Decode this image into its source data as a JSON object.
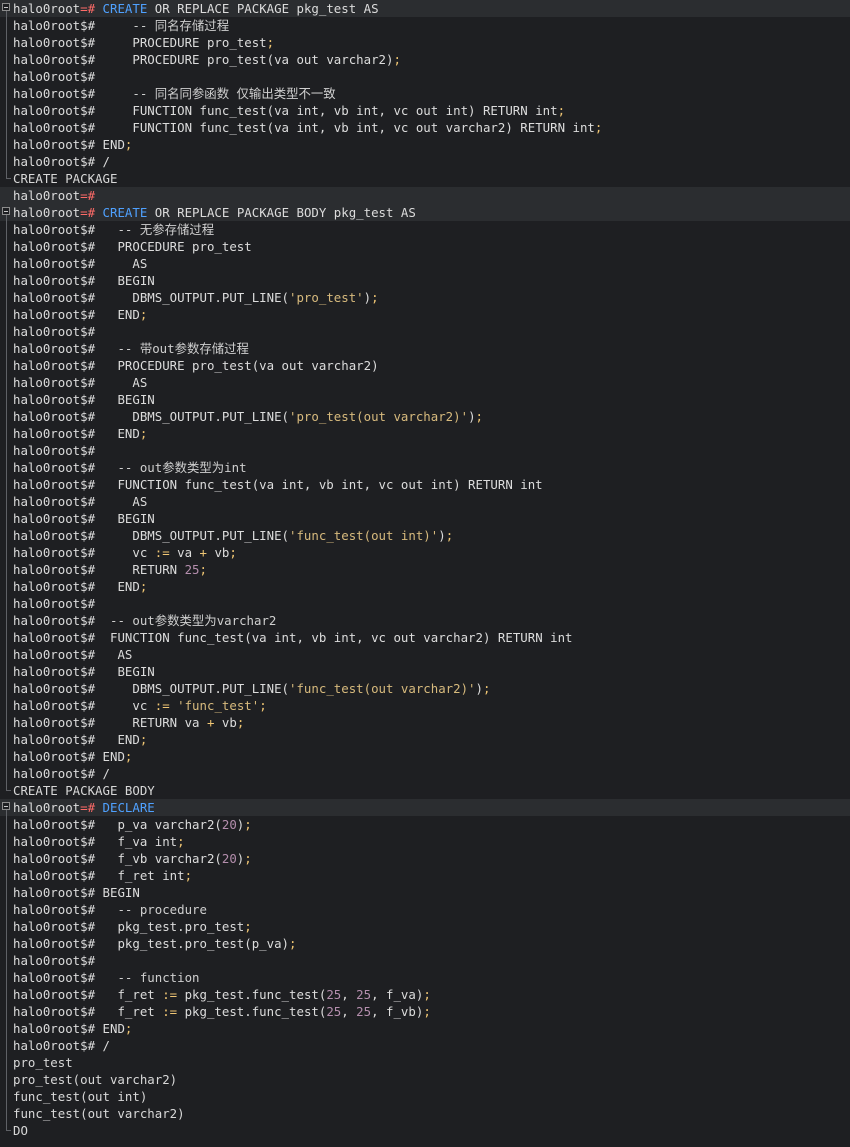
{
  "terminal": {
    "lines": [
      {
        "gutter": "start",
        "hl": true,
        "segs": [
          [
            "t-prompt",
            "halo0root"
          ],
          [
            "t-prompt-accent",
            "=# "
          ],
          [
            "t-kw",
            "CREATE"
          ],
          [
            "t-text",
            " OR REPLACE PACKAGE pkg_test AS"
          ]
        ]
      },
      {
        "gutter": "mid",
        "segs": [
          [
            "t-prompt",
            "halo0root$#     "
          ],
          [
            "t-comment",
            "-- 同名存储过程"
          ]
        ]
      },
      {
        "gutter": "mid",
        "segs": [
          [
            "t-prompt",
            "halo0root$#     "
          ],
          [
            "t-text",
            "PROCEDURE pro_test"
          ],
          [
            "t-op",
            ";"
          ]
        ]
      },
      {
        "gutter": "mid",
        "segs": [
          [
            "t-prompt",
            "halo0root$#     "
          ],
          [
            "t-text",
            "PROCEDURE pro_test(va out varchar2)"
          ],
          [
            "t-op",
            ";"
          ]
        ]
      },
      {
        "gutter": "mid",
        "segs": [
          [
            "t-prompt",
            "halo0root$#"
          ]
        ]
      },
      {
        "gutter": "mid",
        "segs": [
          [
            "t-prompt",
            "halo0root$#     "
          ],
          [
            "t-comment",
            "-- 同名同参函数 仅输出类型不一致"
          ]
        ]
      },
      {
        "gutter": "mid",
        "segs": [
          [
            "t-prompt",
            "halo0root$#     "
          ],
          [
            "t-text",
            "FUNCTION func_test(va int, vb int, vc out int) RETURN int"
          ],
          [
            "t-op",
            ";"
          ]
        ]
      },
      {
        "gutter": "mid",
        "segs": [
          [
            "t-prompt",
            "halo0root$#     "
          ],
          [
            "t-text",
            "FUNCTION func_test(va int, vb int, vc out varchar2) RETURN int"
          ],
          [
            "t-op",
            ";"
          ]
        ]
      },
      {
        "gutter": "mid",
        "segs": [
          [
            "t-prompt",
            "halo0root$# "
          ],
          [
            "t-text",
            "END"
          ],
          [
            "t-op",
            ";"
          ]
        ]
      },
      {
        "gutter": "mid",
        "segs": [
          [
            "t-prompt",
            "halo0root$# "
          ],
          [
            "t-text",
            "/"
          ]
        ]
      },
      {
        "gutter": "end",
        "segs": [
          [
            "t-out",
            "CREATE PACKAGE"
          ]
        ]
      },
      {
        "gutter": "none",
        "hl": true,
        "segs": [
          [
            "t-prompt",
            "halo0root"
          ],
          [
            "t-prompt-accent",
            "=#"
          ]
        ]
      },
      {
        "gutter": "start",
        "hl": true,
        "segs": [
          [
            "t-prompt",
            "halo0root"
          ],
          [
            "t-prompt-accent",
            "=# "
          ],
          [
            "t-kw",
            "CREATE"
          ],
          [
            "t-text",
            " OR REPLACE PACKAGE BODY pkg_test AS"
          ]
        ]
      },
      {
        "gutter": "mid",
        "segs": [
          [
            "t-prompt",
            "halo0root$#   "
          ],
          [
            "t-comment",
            "-- 无参存储过程"
          ]
        ]
      },
      {
        "gutter": "mid",
        "segs": [
          [
            "t-prompt",
            "halo0root$#   "
          ],
          [
            "t-text",
            "PROCEDURE pro_test"
          ]
        ]
      },
      {
        "gutter": "mid",
        "segs": [
          [
            "t-prompt",
            "halo0root$#     "
          ],
          [
            "t-text",
            "AS"
          ]
        ]
      },
      {
        "gutter": "mid",
        "segs": [
          [
            "t-prompt",
            "halo0root$#   "
          ],
          [
            "t-text",
            "BEGIN"
          ]
        ]
      },
      {
        "gutter": "mid",
        "segs": [
          [
            "t-prompt",
            "halo0root$#     "
          ],
          [
            "t-text",
            "DBMS_OUTPUT.PUT_LINE("
          ],
          [
            "t-str",
            "'pro_test'"
          ],
          [
            "t-text",
            ")"
          ],
          [
            "t-op",
            ";"
          ]
        ]
      },
      {
        "gutter": "mid",
        "segs": [
          [
            "t-prompt",
            "halo0root$#   "
          ],
          [
            "t-text",
            "END"
          ],
          [
            "t-op",
            ";"
          ]
        ]
      },
      {
        "gutter": "mid",
        "segs": [
          [
            "t-prompt",
            "halo0root$#"
          ]
        ]
      },
      {
        "gutter": "mid",
        "segs": [
          [
            "t-prompt",
            "halo0root$#   "
          ],
          [
            "t-comment",
            "-- 带out参数存储过程"
          ]
        ]
      },
      {
        "gutter": "mid",
        "segs": [
          [
            "t-prompt",
            "halo0root$#   "
          ],
          [
            "t-text",
            "PROCEDURE pro_test(va out varchar2)"
          ]
        ]
      },
      {
        "gutter": "mid",
        "segs": [
          [
            "t-prompt",
            "halo0root$#     "
          ],
          [
            "t-text",
            "AS"
          ]
        ]
      },
      {
        "gutter": "mid",
        "segs": [
          [
            "t-prompt",
            "halo0root$#   "
          ],
          [
            "t-text",
            "BEGIN"
          ]
        ]
      },
      {
        "gutter": "mid",
        "segs": [
          [
            "t-prompt",
            "halo0root$#     "
          ],
          [
            "t-text",
            "DBMS_OUTPUT.PUT_LINE("
          ],
          [
            "t-str",
            "'pro_test(out varchar2)'"
          ],
          [
            "t-text",
            ")"
          ],
          [
            "t-op",
            ";"
          ]
        ]
      },
      {
        "gutter": "mid",
        "segs": [
          [
            "t-prompt",
            "halo0root$#   "
          ],
          [
            "t-text",
            "END"
          ],
          [
            "t-op",
            ";"
          ]
        ]
      },
      {
        "gutter": "mid",
        "segs": [
          [
            "t-prompt",
            "halo0root$#"
          ]
        ]
      },
      {
        "gutter": "mid",
        "segs": [
          [
            "t-prompt",
            "halo0root$#   "
          ],
          [
            "t-comment",
            "-- out参数类型为int"
          ]
        ]
      },
      {
        "gutter": "mid",
        "segs": [
          [
            "t-prompt",
            "halo0root$#   "
          ],
          [
            "t-text",
            "FUNCTION func_test(va int, vb int, vc out int) RETURN int"
          ]
        ]
      },
      {
        "gutter": "mid",
        "segs": [
          [
            "t-prompt",
            "halo0root$#     "
          ],
          [
            "t-text",
            "AS"
          ]
        ]
      },
      {
        "gutter": "mid",
        "segs": [
          [
            "t-prompt",
            "halo0root$#   "
          ],
          [
            "t-text",
            "BEGIN"
          ]
        ]
      },
      {
        "gutter": "mid",
        "segs": [
          [
            "t-prompt",
            "halo0root$#     "
          ],
          [
            "t-text",
            "DBMS_OUTPUT.PUT_LINE("
          ],
          [
            "t-str",
            "'func_test(out int)'"
          ],
          [
            "t-text",
            ")"
          ],
          [
            "t-op",
            ";"
          ]
        ]
      },
      {
        "gutter": "mid",
        "segs": [
          [
            "t-prompt",
            "halo0root$#     "
          ],
          [
            "t-text",
            "vc "
          ],
          [
            "t-op",
            ":="
          ],
          [
            "t-text",
            " va "
          ],
          [
            "t-op",
            "+"
          ],
          [
            "t-text",
            " vb"
          ],
          [
            "t-op",
            ";"
          ]
        ]
      },
      {
        "gutter": "mid",
        "segs": [
          [
            "t-prompt",
            "halo0root$#     "
          ],
          [
            "t-text",
            "RETURN "
          ],
          [
            "t-num",
            "25"
          ],
          [
            "t-op",
            ";"
          ]
        ]
      },
      {
        "gutter": "mid",
        "segs": [
          [
            "t-prompt",
            "halo0root$#   "
          ],
          [
            "t-text",
            "END"
          ],
          [
            "t-op",
            ";"
          ]
        ]
      },
      {
        "gutter": "mid",
        "segs": [
          [
            "t-prompt",
            "halo0root$#"
          ]
        ]
      },
      {
        "gutter": "mid",
        "segs": [
          [
            "t-prompt",
            "halo0root$#  "
          ],
          [
            "t-comment",
            "-- out参数类型为varchar2"
          ]
        ]
      },
      {
        "gutter": "mid",
        "segs": [
          [
            "t-prompt",
            "halo0root$#  "
          ],
          [
            "t-text",
            "FUNCTION func_test(va int, vb int, vc out varchar2) RETURN int"
          ]
        ]
      },
      {
        "gutter": "mid",
        "segs": [
          [
            "t-prompt",
            "halo0root$#   "
          ],
          [
            "t-text",
            "AS"
          ]
        ]
      },
      {
        "gutter": "mid",
        "segs": [
          [
            "t-prompt",
            "halo0root$#   "
          ],
          [
            "t-text",
            "BEGIN"
          ]
        ]
      },
      {
        "gutter": "mid",
        "segs": [
          [
            "t-prompt",
            "halo0root$#     "
          ],
          [
            "t-text",
            "DBMS_OUTPUT.PUT_LINE("
          ],
          [
            "t-str",
            "'func_test(out varchar2)'"
          ],
          [
            "t-text",
            ")"
          ],
          [
            "t-op",
            ";"
          ]
        ]
      },
      {
        "gutter": "mid",
        "segs": [
          [
            "t-prompt",
            "halo0root$#     "
          ],
          [
            "t-text",
            "vc "
          ],
          [
            "t-op",
            ":="
          ],
          [
            "t-text",
            " "
          ],
          [
            "t-str",
            "'func_test'"
          ],
          [
            "t-op",
            ";"
          ]
        ]
      },
      {
        "gutter": "mid",
        "segs": [
          [
            "t-prompt",
            "halo0root$#     "
          ],
          [
            "t-text",
            "RETURN va "
          ],
          [
            "t-op",
            "+"
          ],
          [
            "t-text",
            " vb"
          ],
          [
            "t-op",
            ";"
          ]
        ]
      },
      {
        "gutter": "mid",
        "segs": [
          [
            "t-prompt",
            "halo0root$#   "
          ],
          [
            "t-text",
            "END"
          ],
          [
            "t-op",
            ";"
          ]
        ]
      },
      {
        "gutter": "mid",
        "segs": [
          [
            "t-prompt",
            "halo0root$# "
          ],
          [
            "t-text",
            "END"
          ],
          [
            "t-op",
            ";"
          ]
        ]
      },
      {
        "gutter": "mid",
        "segs": [
          [
            "t-prompt",
            "halo0root$# "
          ],
          [
            "t-text",
            "/"
          ]
        ]
      },
      {
        "gutter": "end",
        "segs": [
          [
            "t-out",
            "CREATE PACKAGE BODY"
          ]
        ]
      },
      {
        "gutter": "start",
        "hl": true,
        "segs": [
          [
            "t-prompt",
            "halo0root"
          ],
          [
            "t-prompt-accent",
            "=# "
          ],
          [
            "t-kw",
            "DECLARE"
          ]
        ]
      },
      {
        "gutter": "mid",
        "segs": [
          [
            "t-prompt",
            "halo0root$#   "
          ],
          [
            "t-text",
            "p_va varchar2("
          ],
          [
            "t-num",
            "20"
          ],
          [
            "t-text",
            ")"
          ],
          [
            "t-op",
            ";"
          ]
        ]
      },
      {
        "gutter": "mid",
        "segs": [
          [
            "t-prompt",
            "halo0root$#   "
          ],
          [
            "t-text",
            "f_va int"
          ],
          [
            "t-op",
            ";"
          ]
        ]
      },
      {
        "gutter": "mid",
        "segs": [
          [
            "t-prompt",
            "halo0root$#   "
          ],
          [
            "t-text",
            "f_vb varchar2("
          ],
          [
            "t-num",
            "20"
          ],
          [
            "t-text",
            ")"
          ],
          [
            "t-op",
            ";"
          ]
        ]
      },
      {
        "gutter": "mid",
        "segs": [
          [
            "t-prompt",
            "halo0root$#   "
          ],
          [
            "t-text",
            "f_ret int"
          ],
          [
            "t-op",
            ";"
          ]
        ]
      },
      {
        "gutter": "mid",
        "segs": [
          [
            "t-prompt",
            "halo0root$# "
          ],
          [
            "t-text",
            "BEGIN"
          ]
        ]
      },
      {
        "gutter": "mid",
        "segs": [
          [
            "t-prompt",
            "halo0root$#   "
          ],
          [
            "t-comment",
            "-- procedure"
          ]
        ]
      },
      {
        "gutter": "mid",
        "segs": [
          [
            "t-prompt",
            "halo0root$#   "
          ],
          [
            "t-text",
            "pkg_test.pro_test"
          ],
          [
            "t-op",
            ";"
          ]
        ]
      },
      {
        "gutter": "mid",
        "segs": [
          [
            "t-prompt",
            "halo0root$#   "
          ],
          [
            "t-text",
            "pkg_test.pro_test(p_va)"
          ],
          [
            "t-op",
            ";"
          ]
        ]
      },
      {
        "gutter": "mid",
        "segs": [
          [
            "t-prompt",
            "halo0root$#"
          ]
        ]
      },
      {
        "gutter": "mid",
        "segs": [
          [
            "t-prompt",
            "halo0root$#   "
          ],
          [
            "t-comment",
            "-- function"
          ]
        ]
      },
      {
        "gutter": "mid",
        "segs": [
          [
            "t-prompt",
            "halo0root$#   "
          ],
          [
            "t-text",
            "f_ret "
          ],
          [
            "t-op",
            ":="
          ],
          [
            "t-text",
            " pkg_test.func_test("
          ],
          [
            "t-num",
            "25"
          ],
          [
            "t-text",
            ", "
          ],
          [
            "t-num",
            "25"
          ],
          [
            "t-text",
            ", f_va)"
          ],
          [
            "t-op",
            ";"
          ]
        ]
      },
      {
        "gutter": "mid",
        "segs": [
          [
            "t-prompt",
            "halo0root$#   "
          ],
          [
            "t-text",
            "f_ret "
          ],
          [
            "t-op",
            ":="
          ],
          [
            "t-text",
            " pkg_test.func_test("
          ],
          [
            "t-num",
            "25"
          ],
          [
            "t-text",
            ", "
          ],
          [
            "t-num",
            "25"
          ],
          [
            "t-text",
            ", f_vb)"
          ],
          [
            "t-op",
            ";"
          ]
        ]
      },
      {
        "gutter": "mid",
        "segs": [
          [
            "t-prompt",
            "halo0root$# "
          ],
          [
            "t-text",
            "END"
          ],
          [
            "t-op",
            ";"
          ]
        ]
      },
      {
        "gutter": "mid",
        "segs": [
          [
            "t-prompt",
            "halo0root$# "
          ],
          [
            "t-text",
            "/"
          ]
        ]
      },
      {
        "gutter": "mid",
        "segs": [
          [
            "t-out",
            "pro_test"
          ]
        ]
      },
      {
        "gutter": "mid",
        "segs": [
          [
            "t-out",
            "pro_test(out varchar2)"
          ]
        ]
      },
      {
        "gutter": "mid",
        "segs": [
          [
            "t-out",
            "func_test(out int)"
          ]
        ]
      },
      {
        "gutter": "mid",
        "segs": [
          [
            "t-out",
            "func_test(out varchar2)"
          ]
        ]
      },
      {
        "gutter": "end",
        "segs": [
          [
            "t-out",
            "DO"
          ]
        ]
      }
    ]
  }
}
